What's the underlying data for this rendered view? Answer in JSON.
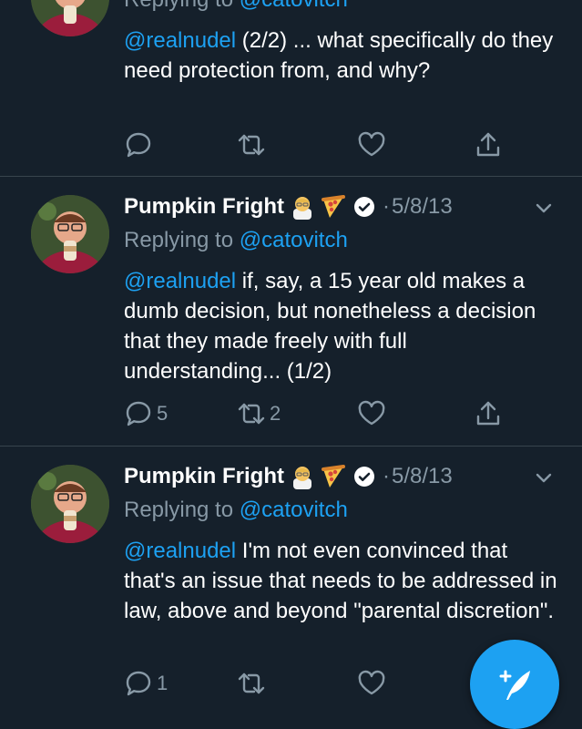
{
  "tweets": [
    {
      "reply_prefix": "Replying to",
      "reply_handle": "@catovitch",
      "mention": "@realnudel",
      "text": " (2/2) ... what specifically do they need protection from, and why?",
      "replies": "",
      "retweets": "",
      "likes": ""
    },
    {
      "name": "Pumpkin Fright",
      "date": "5/8/13",
      "reply_prefix": "Replying to",
      "reply_handle": "@catovitch",
      "mention": "@realnudel",
      "text": " if, say, a 15 year old makes a dumb decision, but nonetheless a decision that they made freely with full understanding... (1/2)",
      "replies": "5",
      "retweets": "2",
      "likes": ""
    },
    {
      "name": "Pumpkin Fright",
      "date": "5/8/13",
      "reply_prefix": "Replying to",
      "reply_handle": "@catovitch",
      "mention": "@realnudel",
      "text": " I'm not even convinced that that's an issue that needs to be addressed in law, above and beyond \"parental discretion\".",
      "replies": "1",
      "retweets": "",
      "likes": ""
    }
  ],
  "separator": "·",
  "icons": {
    "reply": "reply-icon",
    "retweet": "retweet-icon",
    "like": "heart-icon",
    "share": "share-icon",
    "verified": "verified-badge-icon",
    "emoji1": "scientist-emoji-icon",
    "emoji2": "pizza-emoji-icon",
    "menu": "chevron-down-icon",
    "compose": "compose-tweet-icon"
  },
  "colors": {
    "background": "#15202b",
    "accent": "#1da1f2",
    "muted": "#8899a6",
    "divider": "#38444d"
  }
}
